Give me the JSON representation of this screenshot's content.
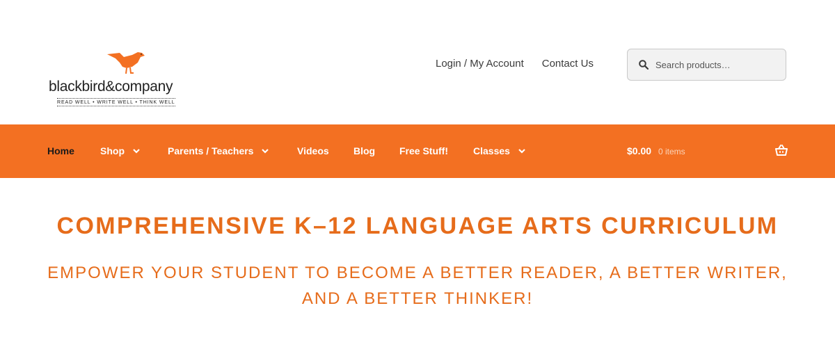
{
  "logo": {
    "wordmark": "blackbird&company",
    "tagline": "READ WELL • WRITE WELL • THINK WELL",
    "icon": "bird-logo-icon"
  },
  "top_links": [
    "Login / My Account",
    "Contact Us"
  ],
  "search": {
    "placeholder": "Search products…",
    "value": ""
  },
  "nav": {
    "items": [
      {
        "label": "Home",
        "active": true
      },
      {
        "label": "Shop",
        "dropdown": true
      },
      {
        "label": "Parents / Teachers",
        "dropdown": true
      },
      {
        "label": "Videos"
      },
      {
        "label": "Blog"
      },
      {
        "label": "Free Stuff!"
      },
      {
        "label": "Classes",
        "dropdown": true
      }
    ],
    "cart_amount": "$0.00",
    "cart_count": "0 items"
  },
  "hero": {
    "title": "COMPREHENSIVE K–12 LANGUAGE ARTS CURRICULUM",
    "subtitle_line1": "EMPOWER YOUR STUDENT TO BECOME A BETTER READER, A BETTER WRITER,",
    "subtitle_line2": "AND A BETTER THINKER!"
  },
  "colors": {
    "brand_orange": "#f37022",
    "hero_text": "#e66c1b"
  }
}
